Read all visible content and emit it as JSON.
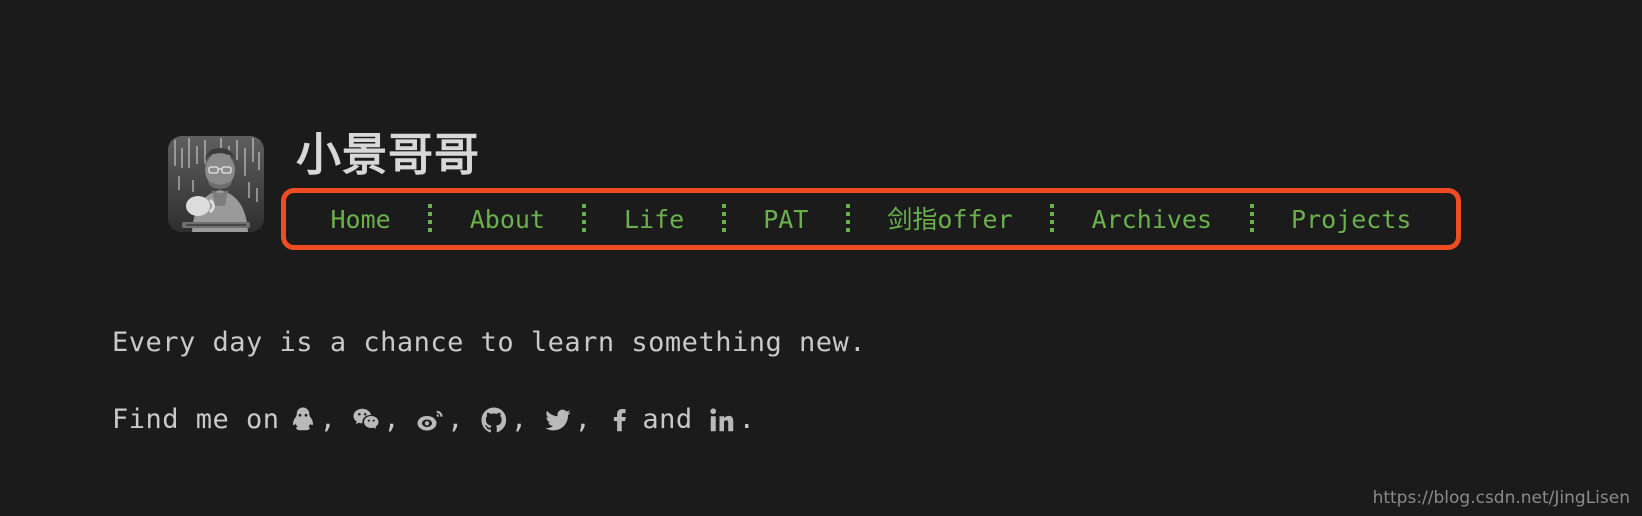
{
  "page": {
    "background_color": "#1b1b1b",
    "accent_green": "#6ab04c",
    "annotation_orange": "#ef4c23",
    "text_color": "#c9c9c9"
  },
  "header": {
    "avatar_alt": "avatar-photo-person-with-mug",
    "site_title": "小景哥哥"
  },
  "nav": {
    "items": [
      {
        "label": "Home"
      },
      {
        "label": "About"
      },
      {
        "label": "Life"
      },
      {
        "label": "PAT"
      },
      {
        "label": "剑指offer"
      },
      {
        "label": "Archives"
      },
      {
        "label": "Projects"
      }
    ]
  },
  "main": {
    "tagline": "Every day is a chance to learn something new.",
    "find_me": {
      "prefix": "Find me on",
      "separator": ",",
      "conjunction": "and",
      "suffix": ".",
      "socials": [
        {
          "name": "qq-icon",
          "label": "QQ"
        },
        {
          "name": "wechat-icon",
          "label": "WeChat"
        },
        {
          "name": "weibo-icon",
          "label": "Weibo"
        },
        {
          "name": "github-icon",
          "label": "GitHub"
        },
        {
          "name": "twitter-icon",
          "label": "Twitter"
        },
        {
          "name": "facebook-icon",
          "label": "Facebook"
        },
        {
          "name": "linkedin-icon",
          "label": "LinkedIn"
        }
      ]
    }
  },
  "watermark": {
    "text": "https://blog.csdn.net/JingLisen"
  }
}
